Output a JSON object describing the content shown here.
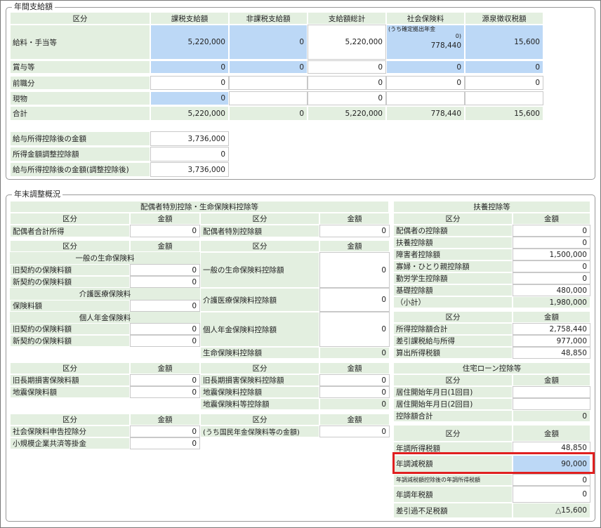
{
  "annual": {
    "legend": "年間支給額",
    "headers": [
      "区分",
      "課税支給額",
      "非課税支給額",
      "支給額総計",
      "社会保険料",
      "源泉徴収税額"
    ],
    "rows": [
      {
        "label": "給料・手当等",
        "taxable": "5,220,000",
        "nontaxable": "0",
        "total": "5,220,000",
        "social_note": "(うち確定拠出年金",
        "social_note2": "0)",
        "social": "778,440",
        "withholding": "15,600"
      },
      {
        "label": "賞与等",
        "taxable": "0",
        "nontaxable": "0",
        "total": "0",
        "social": "0",
        "withholding": "0"
      },
      {
        "label": "前職分",
        "taxable": "0",
        "nontaxable": "",
        "total": "0",
        "social": "0",
        "withholding": "0"
      },
      {
        "label": "現物",
        "taxable": "0",
        "nontaxable": "",
        "total": "0",
        "social": "",
        "withholding": ""
      },
      {
        "label": "合計",
        "taxable": "5,220,000",
        "nontaxable": "0",
        "total": "5,220,000",
        "social": "778,440",
        "withholding": "15,600"
      }
    ],
    "after": [
      {
        "label": "給与所得控除後の金額",
        "value": "3,736,000"
      },
      {
        "label": "所得金額調整控除額",
        "value": "0"
      },
      {
        "label": "給与所得控除後の金額(調整控除後)",
        "value": "3,736,000"
      }
    ]
  },
  "year_end": {
    "legend": "年末調整概況",
    "spouse_ins_title": "配偶者特別控除・生命保険料控除等",
    "kubun": "区分",
    "kingaku": "金額",
    "spouse_total_label": "配偶者合計所得",
    "spouse_total": "0",
    "spouse_special_label": "配偶者特別控除額",
    "spouse_special": "0",
    "general_life": "一般の生命保険料",
    "old_contract": "旧契約の保険料額",
    "old_contract_val": "0",
    "new_contract": "新契約の保険料額",
    "new_contract_val": "0",
    "general_life_ded": "一般の生命保険料控除額",
    "general_life_ded_val": "0",
    "care_title": "介護医療保険料",
    "premium": "保険料額",
    "premium_val": "0",
    "care_ded": "介護医療保険料控除額",
    "care_ded_val": "0",
    "pension_title": "個人年金保険料",
    "pen_old": "旧契約の保険料額",
    "pen_old_val": "0",
    "pen_new": "新契約の保険料額",
    "pen_new_val": "0",
    "pension_ded": "個人年金保険料控除額",
    "pension_ded_val": "0",
    "life_ded": "生命保険料控除額",
    "life_ded_val": "0",
    "old_long": "旧長期損害保険料額",
    "old_long_val": "0",
    "eq_premium": "地震保険料額",
    "eq_premium_val": "0",
    "old_long_ded": "旧長期損害保険料控除額",
    "old_long_ded_val": "0",
    "eq_ded": "地震保険料控除額",
    "eq_ded_val": "0",
    "eq_total_ded": "地震保険料等控除額",
    "eq_total_ded_val": "0",
    "social_decl": "社会保険料申告控除分",
    "social_decl_val": "0",
    "small_biz": "小規模企業共済等掛金",
    "small_biz_val": "0",
    "national_pension": "(うち国民年金保険料等の金額)",
    "national_pension_val": "0",
    "dep_title": "扶養控除等",
    "dep_rows": [
      {
        "label": "配偶者の控除額",
        "value": "0"
      },
      {
        "label": "扶養控除額",
        "value": "0"
      },
      {
        "label": "障害者控除額",
        "value": "1,500,000"
      },
      {
        "label": "寡婦・ひとり親控除額",
        "value": "0"
      },
      {
        "label": "勤労学生控除額",
        "value": "0"
      },
      {
        "label": "基礎控除額",
        "value": "480,000"
      },
      {
        "label": "（小計）",
        "value": "1,980,000"
      }
    ],
    "income_rows": [
      {
        "label": "所得控除額合計",
        "value": "2,758,440"
      },
      {
        "label": "差引課税給与所得",
        "value": "977,000"
      },
      {
        "label": "算出所得税額",
        "value": "48,850"
      }
    ],
    "housing_title": "住宅ローン控除等",
    "housing_rows": [
      {
        "label": "居住開始年月日(1回目)",
        "value": ""
      },
      {
        "label": "居住開始年月日(2回目)",
        "value": ""
      },
      {
        "label": "控除額合計",
        "value": "0"
      }
    ],
    "tax_rows": [
      {
        "label": "年調所得税額",
        "value": "48,850"
      },
      {
        "label": "年調減税額",
        "value": "90,000"
      },
      {
        "label": "年調減税額控除後の年調所得税額",
        "value": "0"
      },
      {
        "label": "年調年税額",
        "value": "0"
      },
      {
        "label": "差引過不足税額",
        "value": "△15,600"
      }
    ]
  }
}
